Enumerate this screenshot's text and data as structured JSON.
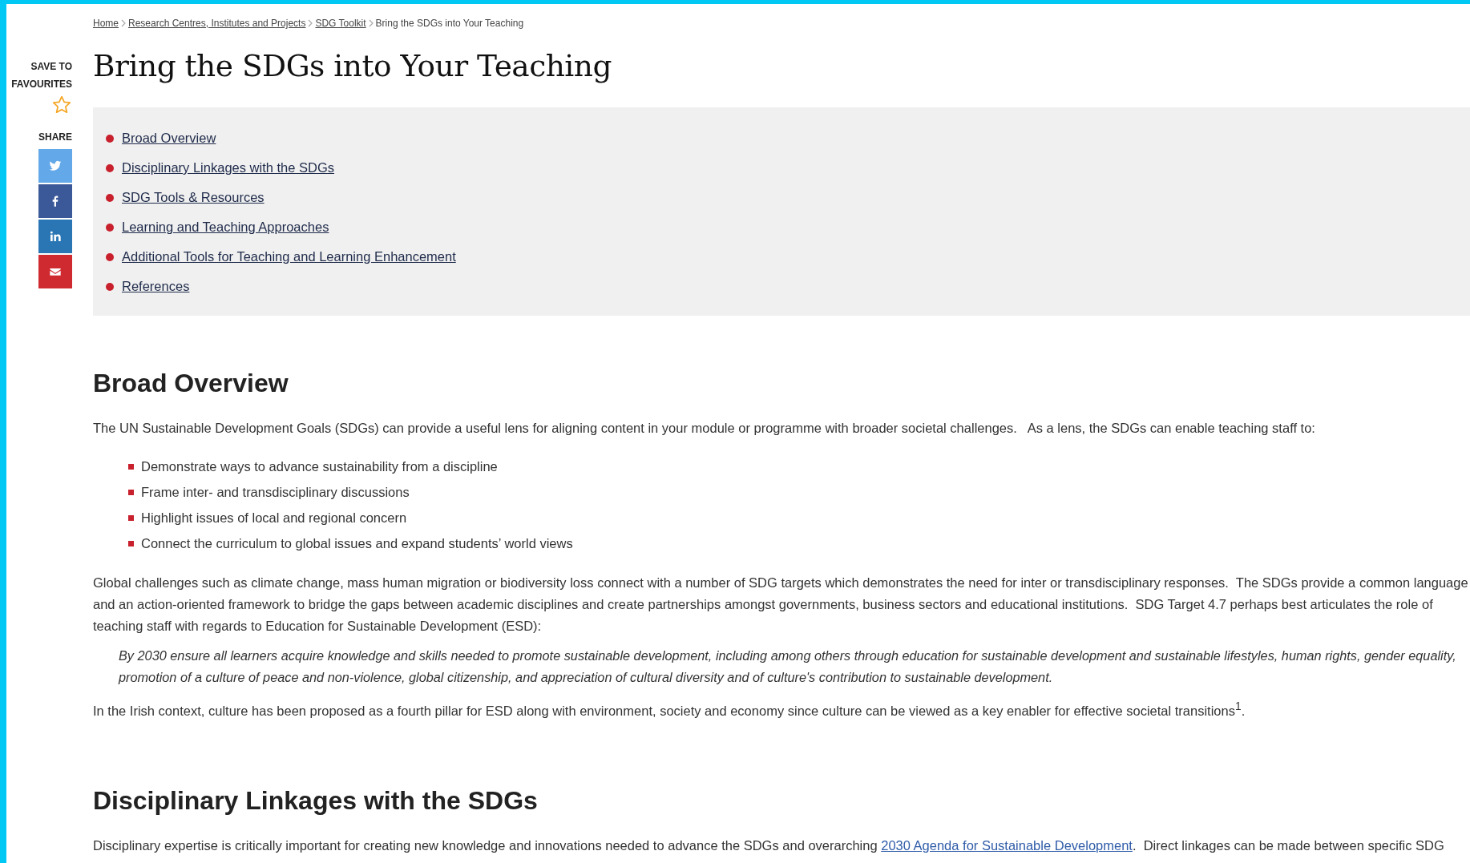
{
  "sidebar": {
    "save_label": "SAVE TO FAVOURITES",
    "favourite": false,
    "share_label": "SHARE",
    "share_buttons": [
      {
        "kind": "twitter"
      },
      {
        "kind": "facebook"
      },
      {
        "kind": "linkedin"
      },
      {
        "kind": "email"
      }
    ]
  },
  "breadcrumb": [
    {
      "label": "Home",
      "link": true
    },
    {
      "label": "Research Centres, Institutes and Projects",
      "link": true
    },
    {
      "label": "SDG Toolkit",
      "link": true
    },
    {
      "label": "Bring the SDGs into Your Teaching",
      "link": false
    }
  ],
  "page_title": "Bring the SDGs into Your Teaching",
  "contents": [
    "Broad Overview",
    "Disciplinary Linkages with the SDGs",
    "SDG Tools & Resources",
    "Learning and Teaching Approaches",
    "Additional Tools for Teaching and Learning Enhancement",
    "References"
  ],
  "sections": [
    {
      "heading": "Broad Overview",
      "blocks": [
        {
          "kind": "paragraph",
          "text": "The UN Sustainable Development Goals (SDGs) can provide a useful lens for aligning content in your module or programme with broader societal challenges.   As a lens, the SDGs can enable teaching staff to:"
        },
        {
          "kind": "list",
          "items": [
            "Demonstrate ways to advance sustainability from a discipline",
            "Frame inter- and transdisciplinary discussions",
            "Highlight issues of local and regional concern",
            "Connect the curriculum to global issues and expand students’ world views"
          ]
        },
        {
          "kind": "paragraph",
          "text": "Global challenges such as climate change, mass human migration or biodiversity loss connect with a number of SDG targets which demonstrates the need for inter or transdisciplinary responses.  The SDGs provide a common language and an action-oriented framework to bridge the gaps between academic disciplines and create partnerships amongst governments, business sectors and educational institutions.  SDG Target 4.7 perhaps best articulates the role of teaching staff with regards to Education for Sustainable Development (ESD):"
        },
        {
          "kind": "quote",
          "text": "By 2030 ensure all learners acquire knowledge and skills needed to promote sustainable development, including among others through education for sustainable development and sustainable lifestyles, human rights, gender equality, promotion of a culture of peace and non-violence, global citizenship, and appreciation of cultural diversity and of culture's contribution to sustainable development."
        },
        {
          "kind": "paragraph",
          "text": "In the Irish context, culture has been proposed as a fourth pillar for ESD along with environment, society and economy since culture can be viewed as a key enabler for effective societal transitions$^{1}$."
        }
      ]
    },
    {
      "heading": "Disciplinary Linkages with the SDGs",
      "blocks": [
        {
          "kind": "linked_paragraph",
          "before": "Disciplinary expertise is critically important for creating new knowledge and innovations needed to advance the SDGs and overarching ",
          "link": "2030 Agenda for Sustainable Development",
          "after": ".  Direct linkages can be made between specific SDG"
        }
      ]
    }
  ]
}
